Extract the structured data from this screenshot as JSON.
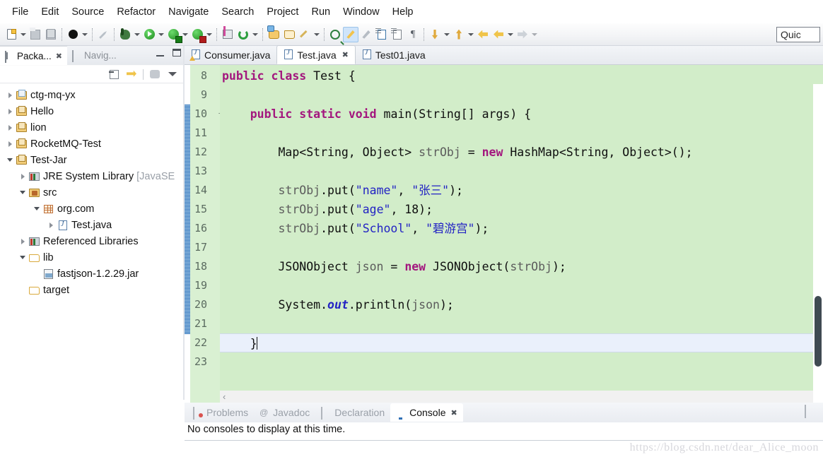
{
  "menubar": {
    "items": [
      {
        "label": "File"
      },
      {
        "label": "Edit"
      },
      {
        "label": "Source"
      },
      {
        "label": "Refactor"
      },
      {
        "label": "Navigate"
      },
      {
        "label": "Search"
      },
      {
        "label": "Project"
      },
      {
        "label": "Run"
      },
      {
        "label": "Window"
      },
      {
        "label": "Help"
      }
    ]
  },
  "toolbar": {
    "quick_access_text": "Quic",
    "icons": [
      "new-wizard-icon",
      "save-icon",
      "save-all-icon",
      "skip-breakpoints-icon",
      "debug-icon",
      "run-icon",
      "run-external-tools-icon",
      "coverage-icon",
      "new-java-package-icon",
      "refresh-icon",
      "open-type-icon",
      "open-task-icon",
      "search-icon",
      "toggle-markoccurrences-icon",
      "next-annotation-icon",
      "previous-annotation-icon",
      "last-edit-location-icon",
      "back-icon",
      "forward-icon"
    ]
  },
  "left_panel": {
    "tabs": [
      {
        "label": "Packa...",
        "icon": "package-explorer-icon",
        "active": true,
        "closable": true
      },
      {
        "label": "Navig...",
        "icon": "navigator-icon",
        "active": false,
        "closable": false
      }
    ],
    "window_buttons": [
      "minimize-button",
      "maximize-button"
    ],
    "view_toolbar": [
      "collapse-all-icon",
      "link-with-editor-icon",
      "view-menu-icon"
    ],
    "tree": [
      {
        "label": "ctg-mq-yx",
        "indent": 0,
        "twisty": "right",
        "icon": "java-project-icon"
      },
      {
        "label": "Hello",
        "indent": 0,
        "twisty": "right",
        "icon": "java-project-icon"
      },
      {
        "label": "lion",
        "indent": 0,
        "twisty": "right",
        "icon": "java-project-icon"
      },
      {
        "label": "RocketMQ-Test",
        "indent": 0,
        "twisty": "right",
        "icon": "java-project-icon"
      },
      {
        "label": "Test-Jar",
        "indent": 0,
        "twisty": "down",
        "icon": "java-project-icon"
      },
      {
        "label": "JRE System Library ",
        "label_dim": "[JavaSE",
        "indent": 1,
        "twisty": "right",
        "icon": "library-icon"
      },
      {
        "label": "src",
        "indent": 1,
        "twisty": "down",
        "icon": "source-folder-icon"
      },
      {
        "label": "org.com",
        "indent": 2,
        "twisty": "down",
        "icon": "package-icon"
      },
      {
        "label": "Test.java",
        "indent": 3,
        "twisty": "right",
        "icon": "java-file-icon"
      },
      {
        "label": "Referenced Libraries",
        "indent": 1,
        "twisty": "right",
        "icon": "library-icon"
      },
      {
        "label": "lib",
        "indent": 1,
        "twisty": "down",
        "icon": "folder-icon"
      },
      {
        "label": "fastjson-1.2.29.jar",
        "indent": 2,
        "twisty": "none",
        "icon": "jar-icon"
      },
      {
        "label": "target",
        "indent": 1,
        "twisty": "none",
        "icon": "folder-icon"
      }
    ]
  },
  "editor": {
    "tabs": [
      {
        "label": "Consumer.java",
        "active": false,
        "closable": false,
        "warning": true
      },
      {
        "label": "Test.java",
        "active": true,
        "closable": true,
        "warning": false
      },
      {
        "label": "Test01.java",
        "active": false,
        "closable": false,
        "warning": false
      }
    ],
    "first_visible_line": 7,
    "cursor_line": 22,
    "changed_lines": {
      "from": 10,
      "to": 22
    },
    "lines": [
      {
        "n": 8,
        "fold": "",
        "tokens": [
          {
            "t": "public ",
            "c": "kw"
          },
          {
            "t": "class ",
            "c": "kw"
          },
          {
            "t": "Test {",
            "c": ""
          }
        ]
      },
      {
        "n": 9,
        "fold": "",
        "tokens": [
          {
            "t": "",
            "c": ""
          }
        ]
      },
      {
        "n": 10,
        "fold": "-",
        "tokens": [
          {
            "t": "    ",
            "c": ""
          },
          {
            "t": "public static void ",
            "c": "kw"
          },
          {
            "t": "main(String[] args) {",
            "c": ""
          }
        ]
      },
      {
        "n": 11,
        "fold": "",
        "tokens": [
          {
            "t": "",
            "c": ""
          }
        ]
      },
      {
        "n": 12,
        "fold": "",
        "tokens": [
          {
            "t": "        Map<String, Object> ",
            "c": ""
          },
          {
            "t": "strObj",
            "c": "var"
          },
          {
            "t": " = ",
            "c": ""
          },
          {
            "t": "new ",
            "c": "kw"
          },
          {
            "t": "HashMap<String, Object>();",
            "c": ""
          }
        ]
      },
      {
        "n": 13,
        "fold": "",
        "tokens": [
          {
            "t": "",
            "c": ""
          }
        ]
      },
      {
        "n": 14,
        "fold": "",
        "tokens": [
          {
            "t": "        ",
            "c": ""
          },
          {
            "t": "strObj",
            "c": "var"
          },
          {
            "t": ".put(",
            "c": ""
          },
          {
            "t": "\"name\"",
            "c": "str"
          },
          {
            "t": ", ",
            "c": ""
          },
          {
            "t": "\"张三\"",
            "c": "str"
          },
          {
            "t": ");",
            "c": ""
          }
        ]
      },
      {
        "n": 15,
        "fold": "",
        "tokens": [
          {
            "t": "        ",
            "c": ""
          },
          {
            "t": "strObj",
            "c": "var"
          },
          {
            "t": ".put(",
            "c": ""
          },
          {
            "t": "\"age\"",
            "c": "str"
          },
          {
            "t": ", 18);",
            "c": ""
          }
        ]
      },
      {
        "n": 16,
        "fold": "",
        "tokens": [
          {
            "t": "        ",
            "c": ""
          },
          {
            "t": "strObj",
            "c": "var"
          },
          {
            "t": ".put(",
            "c": ""
          },
          {
            "t": "\"School\"",
            "c": "str"
          },
          {
            "t": ", ",
            "c": ""
          },
          {
            "t": "\"碧游宫\"",
            "c": "str"
          },
          {
            "t": ");",
            "c": ""
          }
        ]
      },
      {
        "n": 17,
        "fold": "",
        "tokens": [
          {
            "t": "",
            "c": ""
          }
        ]
      },
      {
        "n": 18,
        "fold": "",
        "tokens": [
          {
            "t": "        JSONObject ",
            "c": ""
          },
          {
            "t": "json",
            "c": "var"
          },
          {
            "t": " = ",
            "c": ""
          },
          {
            "t": "new ",
            "c": "kw"
          },
          {
            "t": "JSONObject(",
            "c": ""
          },
          {
            "t": "strObj",
            "c": "var"
          },
          {
            "t": ");",
            "c": ""
          }
        ]
      },
      {
        "n": 19,
        "fold": "",
        "tokens": [
          {
            "t": "",
            "c": ""
          }
        ]
      },
      {
        "n": 20,
        "fold": "",
        "tokens": [
          {
            "t": "        System.",
            "c": ""
          },
          {
            "t": "out",
            "c": "fld"
          },
          {
            "t": ".println(",
            "c": ""
          },
          {
            "t": "json",
            "c": "var"
          },
          {
            "t": ");",
            "c": ""
          }
        ]
      },
      {
        "n": 21,
        "fold": "",
        "tokens": [
          {
            "t": "",
            "c": ""
          }
        ]
      },
      {
        "n": 22,
        "fold": "",
        "tokens": [
          {
            "t": "    }",
            "c": ""
          }
        ],
        "caret": true
      },
      {
        "n": 23,
        "fold": "",
        "tokens": [
          {
            "t": "",
            "c": ""
          }
        ]
      }
    ]
  },
  "bottom_panel": {
    "tabs": [
      {
        "label": "Problems",
        "icon": "problems-icon",
        "active": false,
        "closable": false
      },
      {
        "label": "Javadoc",
        "icon": "javadoc-icon",
        "active": false,
        "closable": false
      },
      {
        "label": "Declaration",
        "icon": "declaration-icon",
        "active": false,
        "closable": false
      },
      {
        "label": "Console",
        "icon": "console-icon",
        "active": true,
        "closable": true
      }
    ],
    "message": "No consoles to display at this time."
  },
  "watermark": "https://blog.csdn.net/dear_Alice_moon",
  "colors": {
    "editor_background": "#d2edc9",
    "gutter_background": "#d9f0d2",
    "keyword": "#a3177e",
    "string": "#2323c4",
    "field": "#2323c4",
    "variable": "#5c5c5c",
    "cursor_line": "#eaf0fb",
    "changed_marker": "#3a7bbf",
    "tab_active": "#ffffff"
  }
}
